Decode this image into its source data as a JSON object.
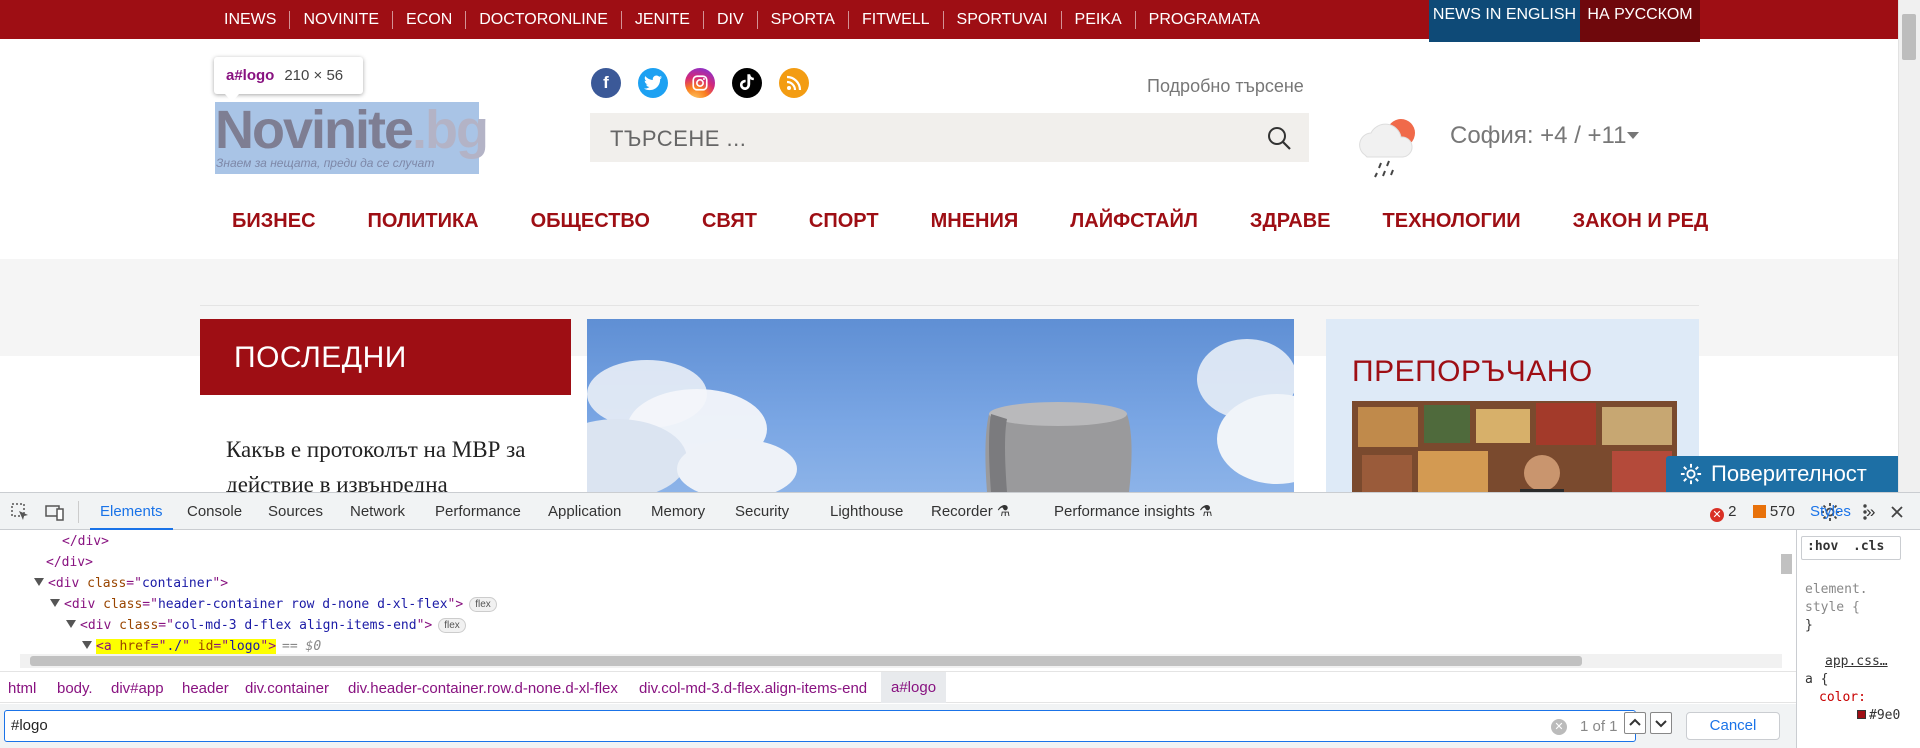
{
  "top_nav": {
    "items": [
      "INEWS",
      "NOVINITE",
      "ECON",
      "DOCTORONLINE",
      "JENITE",
      "DIV",
      "SPORTA",
      "FITWELL",
      "SPORTUVAI",
      "PEIKA",
      "PROGRAMATA"
    ],
    "english": "NEWS IN ENGLISH",
    "russian": "НА РУССКОМ"
  },
  "inspect_tooltip": {
    "selector": "a#logo",
    "size": "210 × 56"
  },
  "logo": {
    "main": "Novinite",
    "tld": ".bg",
    "slogan": "Знаем за нещата, преди да се случат"
  },
  "header": {
    "advanced_search": "Подробно търсене",
    "search_placeholder": "ТЪРСЕНЕ ...",
    "weather": "София: +4 / +11"
  },
  "categories": [
    "БИЗНЕС",
    "ПОЛИТИКА",
    "ОБЩЕСТВО",
    "СВЯТ",
    "СПОРТ",
    "МНЕНИЯ",
    "ЛАЙФСТАЙЛ",
    "ЗДРАВЕ",
    "ТЕХНОЛОГИИ",
    "ЗАКОН И РЕД"
  ],
  "latest": {
    "heading": "ПОСЛЕДНИ",
    "text": "Какъв е протоколът на МВР за действие в извънредна"
  },
  "recommended": {
    "heading": "ПРЕПОРЪЧАНО"
  },
  "privacy_button": "Поверителност",
  "devtools": {
    "tabs": [
      "Elements",
      "Console",
      "Sources",
      "Network",
      "Performance",
      "Application",
      "Memory",
      "Security",
      "Lighthouse",
      "Recorder",
      "Performance insights"
    ],
    "error_count": "2",
    "warning_count": "570",
    "dom_lines": {
      "l1": "</div>",
      "l2": "</div>",
      "l3_tag": "div",
      "l3_attr": "class",
      "l3_val": "container",
      "l4_tag": "div",
      "l4_attr": "class",
      "l4_val": "header-container row d-none d-xl-flex",
      "l4_chip": "flex",
      "l5_tag": "div",
      "l5_attr": "class",
      "l5_val": "col-md-3 d-flex align-items-end",
      "l5_chip": "flex",
      "l6_tag": "a",
      "l6_attr1": "href",
      "l6_val1": "./",
      "l6_attr2": "id",
      "l6_val2": "logo",
      "l6_suffix": "== $0"
    },
    "breadcrumb": [
      "html",
      "body.",
      "div#app",
      "header",
      "div.container",
      "div.header-container.row.d-none.d-xl-flex",
      "div.col-md-3.d-flex.align-items-end",
      "a#logo"
    ],
    "find_value": "#logo",
    "find_count": "1 of 1",
    "cancel": "Cancel",
    "styles": {
      "tab": "Styles",
      "filter_hov": ":hov",
      "filter_cls": ".cls",
      "element_style_1": "element.",
      "element_style_2": "style {",
      "element_style_3": "}",
      "source": "app.css…",
      "rule_selector": "a {",
      "rule_prop": "color:",
      "rule_val": "#9e0"
    }
  },
  "colors": {
    "brand_red": "#9e0e14",
    "english_blue": "#0e4a77",
    "russian_dark_red": "#6f080c",
    "privacy_blue": "#1d6fa5",
    "devtools_accent": "#1a73e8"
  }
}
